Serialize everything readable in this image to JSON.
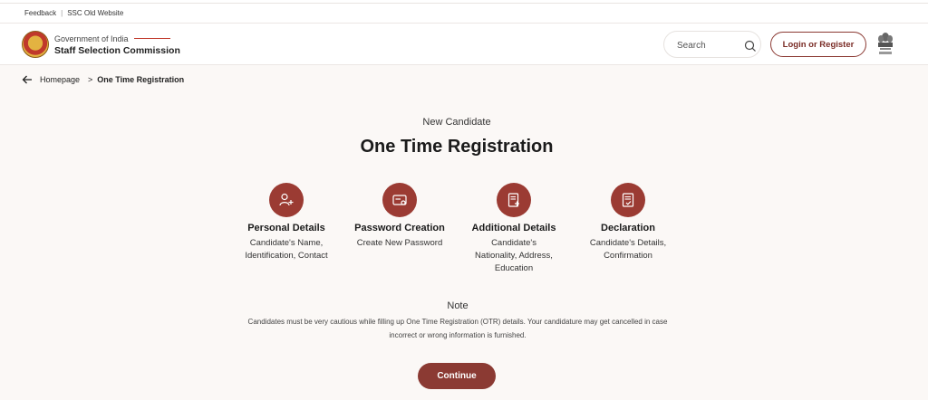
{
  "utility": {
    "feedback": "Feedback",
    "old_site": "SSC Old Website"
  },
  "header": {
    "gov": "Government of India",
    "org": "Staff Selection Commission",
    "search_placeholder": "Search",
    "login_label": "Login or Register"
  },
  "breadcrumb": {
    "home": "Homepage",
    "separator": ">",
    "current": "One Time Registration"
  },
  "page": {
    "subtitle": "New Candidate",
    "title": "One Time Registration"
  },
  "steps": [
    {
      "label": "Personal Details",
      "desc1": "Candidate's Name,",
      "desc2": "Identification, Contact",
      "desc3": "",
      "icon": "user-add-icon"
    },
    {
      "label": "Password Creation",
      "desc1": "Create New Password",
      "desc2": "",
      "desc3": "",
      "icon": "password-card-icon"
    },
    {
      "label": "Additional Details",
      "desc1": "Candidate's",
      "desc2": "Nationality, Address,",
      "desc3": "Education",
      "icon": "document-add-icon"
    },
    {
      "label": "Declaration",
      "desc1": "Candidate's Details,",
      "desc2": "Confirmation",
      "desc3": "",
      "icon": "document-check-icon"
    }
  ],
  "note": {
    "heading": "Note",
    "text": "Candidates must be very cautious while filling up One Time Registration (OTR) details. Your candidature may get cancelled in case incorrect or wrong information is furnished."
  },
  "continue_label": "Continue",
  "colors": {
    "primary": "#8b3a33",
    "background": "#fbf8f6"
  }
}
